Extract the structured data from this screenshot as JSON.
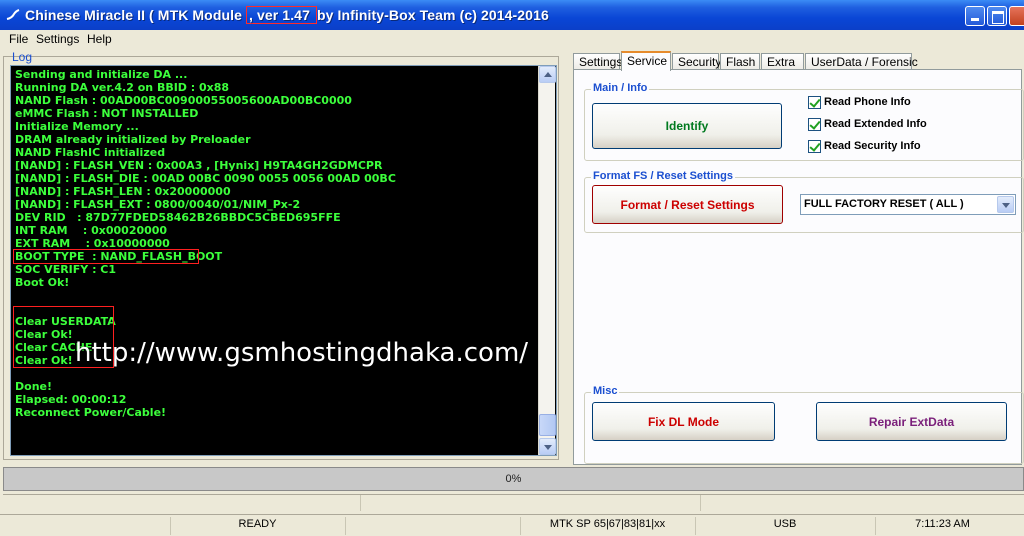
{
  "window": {
    "title_prefix": "Chinese Miracle II ( MTK Module ",
    "title_version": ", ver 1.47 ",
    "title_suffix": "by Infinity-Box Team (c) 2014-2016"
  },
  "menu": {
    "file": "File",
    "settings": "Settings",
    "help": "Help"
  },
  "log": {
    "label": "Log",
    "lines": [
      "Sending and initialize DA ...",
      "Running DA ver.4.2 on BBID : 0x88",
      "NAND Flash : 00AD00BC00900055005600AD00BC0000",
      "eMMC Flash : NOT INSTALLED",
      "Initialize Memory ...",
      "DRAM already initialized by Preloader",
      "NAND FlashIC initialized",
      "[NAND] : FLASH_VEN : 0x00A3 , [Hynix] H9TA4GH2GDMCPR",
      "[NAND] : FLASH_DIE : 00AD 00BC 0090 0055 0056 00AD 00BC",
      "[NAND] : FLASH_LEN : 0x20000000",
      "[NAND] : FLASH_EXT : 0800/0040/01/NIM_Px-2",
      "DEV RID   : 87D77FDED58462B26BBDC5CBED695FFE",
      "INT RAM    : 0x00020000",
      "EXT RAM    : 0x10000000",
      "BOOT TYPE  : NAND_FLASH_BOOT",
      "SOC VERIFY : C1",
      "Boot Ok!",
      "",
      "",
      "Clear USERDATA",
      "Clear Ok!",
      "Clear CACHE",
      "Clear Ok!",
      "",
      "Done!",
      "Elapsed: 00:00:12",
      "Reconnect Power/Cable!"
    ],
    "watermark": "http://www.gsmhostingdhaka.com/"
  },
  "tabs": [
    "Settings",
    "Service",
    "Security",
    "Flash",
    "Extra",
    "UserData / Forensic"
  ],
  "active_tab": "Service",
  "main_info": {
    "label": "Main / Info",
    "identify": "Identify",
    "checks": [
      "Read Phone Info",
      "Read Extended Info",
      "Read Security Info"
    ]
  },
  "format": {
    "label": "Format FS / Reset Settings",
    "button": "Format / Reset Settings",
    "selected": "FULL FACTORY RESET ( ALL )"
  },
  "misc": {
    "label": "Misc",
    "fix_dl": "Fix DL Mode",
    "repair": "Repair ExtData"
  },
  "colors": {
    "log_text": "#3cff3c",
    "format_button": "#cc0000",
    "identify": "#007a1f",
    "fix_dl": "#cc0000",
    "repair": "#7a1f7a"
  },
  "progress": {
    "text": "0%",
    "value": 0
  },
  "status": {
    "state": "READY",
    "platform": "MTK SP 65|67|83|81|xx",
    "interface": "USB",
    "time": "7:11:23 AM"
  }
}
